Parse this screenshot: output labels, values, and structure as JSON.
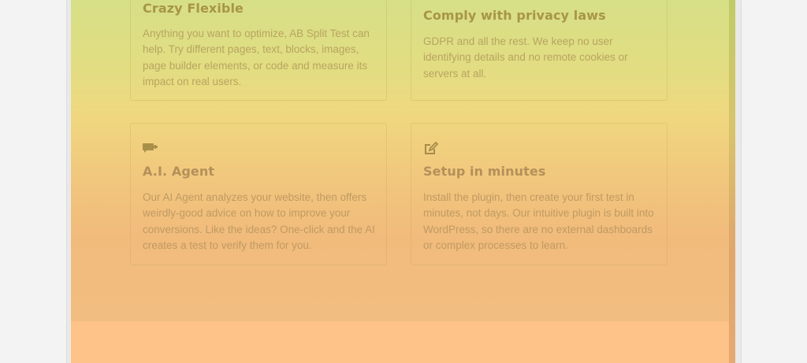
{
  "features": [
    {
      "title": "Crazy Flexible",
      "description": "Anything you want to optimize, AB Split Test can help. Try different pages, text, blocks, images, page builder elements, or code and measure its impact on real users.",
      "icon": "puzzle-icon"
    },
    {
      "title": "Comply with privacy laws",
      "description": "GDPR and all the rest. We keep no user identifying details and no remote cookies or servers at all.",
      "icon": "shield-icon"
    },
    {
      "title": "A.I. Agent",
      "description": "Our AI Agent analyzes your website, then offers weirdly-good advice on how to improve your conversions. Like the ideas? One-click and the AI creates a test to verify them for you.",
      "icon": "ai-agent-icon"
    },
    {
      "title": "Setup in minutes",
      "description": "Install the plugin, then create your first test in minutes, not days. Our intuitive plugin is built into WordPress, so there are no external dashboards or complex processes to learn.",
      "icon": "edit-icon"
    }
  ],
  "colors": {
    "title": "#a89546",
    "description": "#b8a460",
    "icon": "#a08840"
  }
}
